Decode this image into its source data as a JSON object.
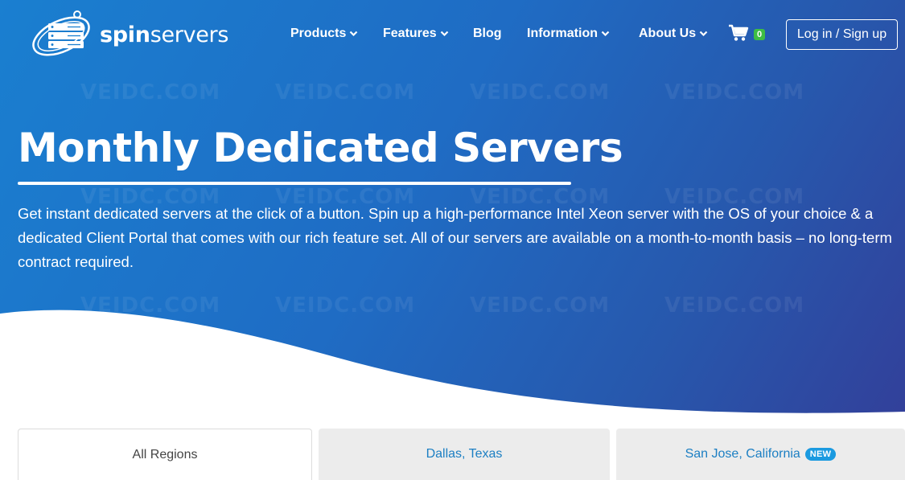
{
  "brand": {
    "name_bold": "spin",
    "name_regular": "servers"
  },
  "nav": {
    "items": [
      {
        "label": "Products",
        "dropdown": true
      },
      {
        "label": "Features",
        "dropdown": true
      },
      {
        "label": "Blog",
        "dropdown": false
      },
      {
        "label": "Information",
        "dropdown": true
      },
      {
        "label": "About Us",
        "dropdown": true
      }
    ],
    "cart_count": "0",
    "login_label": "Log in / Sign up"
  },
  "watermark": "VEIDC.COM",
  "hero": {
    "title": "Monthly Dedicated Servers",
    "intro": "Get instant dedicated servers at the click of a button. Spin up a high-performance Intel Xeon server with the OS of your choice & a dedicated Client Portal that comes with our rich feature set. All of our servers are available on a month-to-month basis – no long-term contract required."
  },
  "tabs": [
    {
      "label": "All Regions",
      "active": true
    },
    {
      "label": "Dallas, Texas",
      "active": false
    },
    {
      "label": "San Jose, California",
      "active": false,
      "badge": "NEW"
    }
  ],
  "colors": {
    "hero_start": "#1a7fd0",
    "hero_end": "#32409a",
    "link": "#1c7fc3",
    "cart_badge": "#3ebd44",
    "new_badge": "#1b9ae0"
  }
}
